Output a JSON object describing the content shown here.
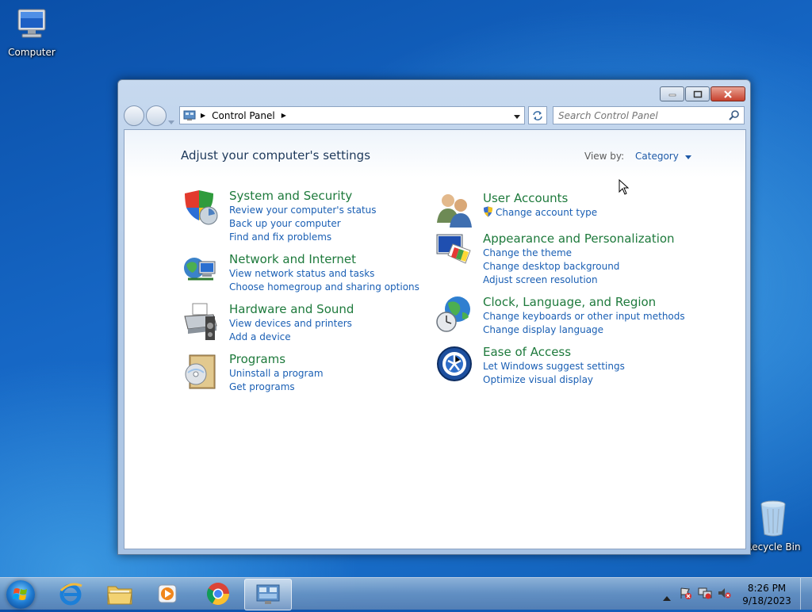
{
  "desktop": {
    "computer_label": "Computer",
    "recycle_label": "Recycle Bin"
  },
  "window": {
    "address": {
      "crumb": "Control Panel"
    },
    "search": {
      "placeholder": "Search Control Panel"
    },
    "heading": "Adjust your computer's settings",
    "view_by": {
      "label": "View by:",
      "value": "Category"
    },
    "left_categories": [
      {
        "title": "System and Security",
        "icon": "shield-icon",
        "links": [
          "Review your computer's status",
          "Back up your computer",
          "Find and fix problems"
        ]
      },
      {
        "title": "Network and Internet",
        "icon": "network-icon",
        "links": [
          "View network status and tasks",
          "Choose homegroup and sharing options"
        ]
      },
      {
        "title": "Hardware and Sound",
        "icon": "printer-icon",
        "links": [
          "View devices and printers",
          "Add a device"
        ]
      },
      {
        "title": "Programs",
        "icon": "programs-icon",
        "links": [
          "Uninstall a program",
          "Get programs"
        ]
      }
    ],
    "right_categories": [
      {
        "title": "User Accounts",
        "icon": "users-icon",
        "links": [
          "Change account type"
        ]
      },
      {
        "title": "Appearance and Personalization",
        "icon": "appearance-icon",
        "links": [
          "Change the theme",
          "Change desktop background",
          "Adjust screen resolution"
        ]
      },
      {
        "title": "Clock, Language, and Region",
        "icon": "globe-clock-icon",
        "links": [
          "Change keyboards or other input methods",
          "Change display language"
        ]
      },
      {
        "title": "Ease of Access",
        "icon": "ease-icon",
        "links": [
          "Let Windows suggest settings",
          "Optimize visual display"
        ]
      }
    ]
  },
  "taskbar": {
    "time": "8:26 PM",
    "date": "9/18/2023",
    "apps": [
      "internet-explorer-icon",
      "file-explorer-icon",
      "media-player-icon",
      "chrome-icon",
      "control-panel-icon"
    ]
  },
  "colors": {
    "link": "#1a5fb4",
    "category_title": "#1e7a3c",
    "heading": "#1e395b"
  }
}
